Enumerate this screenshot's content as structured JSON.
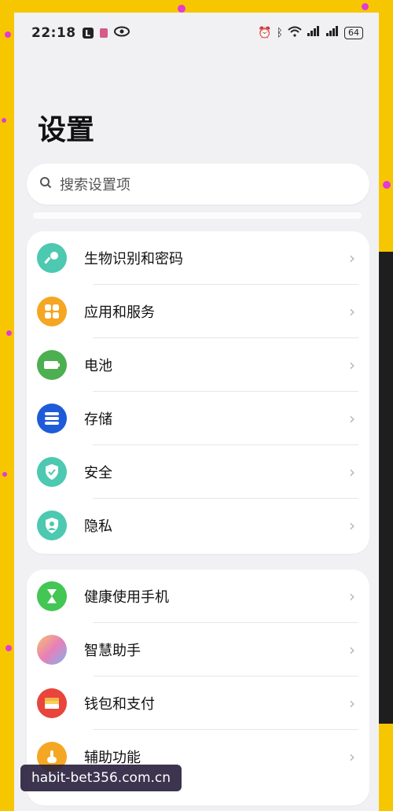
{
  "status_bar": {
    "time": "22:18",
    "battery": "64"
  },
  "page": {
    "title": "设置"
  },
  "search": {
    "placeholder": "搜索设置项"
  },
  "groups": [
    {
      "items": [
        {
          "label": "生物识别和密码",
          "icon": "key-icon",
          "color": "#4cc9b0"
        },
        {
          "label": "应用和服务",
          "icon": "apps-icon",
          "color": "#f5a623"
        },
        {
          "label": "电池",
          "icon": "battery-icon",
          "color": "#4caf50"
        },
        {
          "label": "存储",
          "icon": "storage-icon",
          "color": "#1e5bd8"
        },
        {
          "label": "安全",
          "icon": "shield-icon",
          "color": "#4cc9b0"
        },
        {
          "label": "隐私",
          "icon": "privacy-icon",
          "color": "#4cc9b0"
        }
      ]
    },
    {
      "items": [
        {
          "label": "健康使用手机",
          "icon": "hourglass-icon",
          "color": "#43c653"
        },
        {
          "label": "智慧助手",
          "icon": "assistant-icon",
          "color": "#e8a0c8"
        },
        {
          "label": "钱包和支付",
          "icon": "wallet-icon",
          "color": "#e8453c"
        },
        {
          "label": "辅助功能",
          "icon": "accessibility-icon",
          "color": "#f5a623"
        }
      ]
    }
  ],
  "watermark": {
    "text": "habit-bet356.com.cn"
  }
}
